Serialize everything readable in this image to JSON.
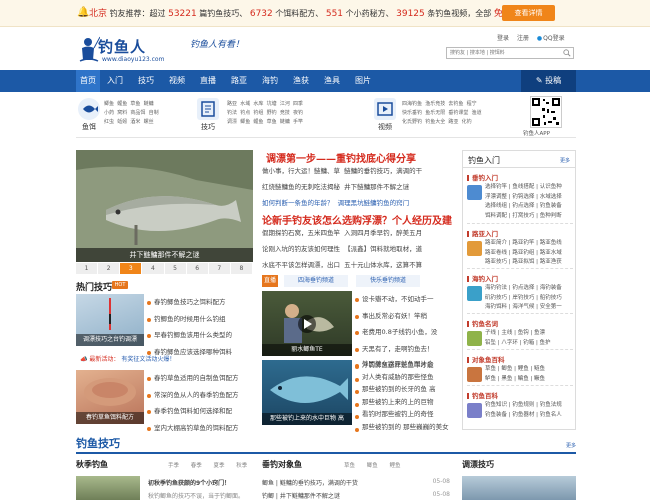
{
  "promo": {
    "location": "北京",
    "prefix": "钓友推荐：超过",
    "n1": "53221",
    "t1": "篇钓鱼技巧、",
    "n2": "6732",
    "t2": "个饵料配方、",
    "n3": "551",
    "t3": "个小药秘方、",
    "n4": "39125",
    "t4": "条钓鱼视频，全部",
    "free": "免费！",
    "button": "查看详情"
  },
  "header": {
    "brand": "钓鱼人",
    "url": "www.diaoyu123.com",
    "slogan": "钓鱼人有看！",
    "login": "登录",
    "register": "注册",
    "qq_login": "QQ登录",
    "search_placeholder": "搜钓友 | 搜本地 | 搜饵料"
  },
  "nav": {
    "items": [
      "首页",
      "入门",
      "技巧",
      "视频",
      "直播",
      "路亚",
      "海钓",
      "渔获",
      "渔具",
      "图片"
    ],
    "post": "投稿"
  },
  "cats": {
    "bait": {
      "name": "鱼饵",
      "links": [
        [
          "鲫鱼",
          "鲤鱼",
          "草鱼",
          "鲢鳙"
        ],
        [
          "小药",
          "窝料",
          "商品饵",
          "自制"
        ],
        [
          "红虫",
          "蚯蚓",
          "酒米",
          "螺丝"
        ]
      ]
    },
    "skill": {
      "name": "技巧",
      "links": [
        [
          "路亚",
          "水域",
          "水库",
          "坑塘",
          "江河",
          "四季"
        ],
        [
          "钓法",
          "钓点",
          "钓组",
          "野钓",
          "竞技",
          "夜钓"
        ],
        [
          "调漂",
          "鲫鱼",
          "鲤鱼",
          "草鱼",
          "鲢鳙",
          "手竿"
        ]
      ]
    },
    "video": {
      "name": "视频",
      "links": [
        [
          "四海钓鱼",
          "渔乐竞技",
          "去钓鱼",
          "程宁"
        ],
        [
          "快乐垂钓",
          "鱼乐无限",
          "垂钓课堂",
          "渔道"
        ],
        [
          "化氏野钓",
          "钓鱼大全",
          "路亚",
          "化钓"
        ]
      ]
    },
    "app": "钓鱼人APP"
  },
  "hero": {
    "caption": "井下鲢鳙那件不解之谜",
    "pages": [
      "1",
      "2",
      "3",
      "4",
      "5",
      "6",
      "7",
      "8"
    ],
    "active_page": "3",
    "headline1": "调漂第一步——重钓找底心得分享",
    "h1_links": [
      [
        "做小事，行大运！鲢鳙、草",
        "鲢鳙的垂钓技巧，满调的干"
      ],
      [
        "红烧鲢鳙鱼的无刺吃法揭秘",
        "井下鲢鳙那件不解之谜"
      ],
      [
        "如何判断一条鱼的年龄？",
        "调理黑坑鲢鳙钓鱼的窍门"
      ]
    ],
    "headline2": "论新手钓友该怎么选购浮漂？个人经历及建",
    "h2_links": [
      [
        "假期探钓石窝，五米四鱼竿",
        "入洞四月季早钓，醉美五月"
      ],
      [
        "论刚入坑的钓友该如何理性",
        "【派鑫】饵料就地取材，道"
      ],
      [
        "水底不平该怎样调漂，出口",
        "五十元山体水库，这算不算"
      ]
    ]
  },
  "hot": {
    "title": "热门技巧",
    "badge": "HOT",
    "thumb1_caption": "调漂技巧之台钓调漂",
    "list1": [
      "春钓鲫鱼技巧之饵料配方",
      "钓鲫鱼的时候用什么钓组",
      "早春钓鲫鱼该用什么类型的",
      "春钓鲫鱼应该选择哪种饵料"
    ],
    "ad": "最新活动：",
    "ad_link": "有奖征文活动火爆！",
    "thumb2_caption": "春钓草鱼饵料配方",
    "list2": [
      "春钓草鱼适用的自制鱼饵配方",
      "常深的鱼从人的春季钓鱼配方",
      "春季钓鱼饵料如何选择和配",
      "室内大棚高钓草鱼的饵料配方"
    ]
  },
  "videos": {
    "tab1": "直播",
    "tab2": "四海垂钓频道",
    "tab3": "快乐垂钓频道",
    "thumb1_caption": "丽水鲫鱼TE",
    "list1": [
      "设卡瓣不动，不如动手一",
      "事出反常必有妖！竿稍",
      "老费用0.8子线钓小鱼，没",
      "天黑有了，走啊钓鱼去！",
      "浮钓鲫鱼这样选鱼平才能"
    ],
    "thumb2_caption": "那些被钓上来的水中巨物 高",
    "list2": [
      "外国美女路亚鲈鱼图片合",
      "对人类有威胁的那些怪鱼",
      "那些被钓到的长牙的鱼 高",
      "那些被钓上来的上的巨物",
      "看钓时那些被钓上的奇怪",
      "那些被钓到的 那些巍巍的美女"
    ]
  },
  "rcol": {
    "title": "钓鱼入门",
    "more": "更多",
    "blocks": [
      {
        "title": "垂钓入门",
        "links": [
          "选择钓竿 | 鱼线搭配 | 认识鱼种",
          "浮漂调整 | 钓钩选择 | 水域选择",
          "选择线组 | 钓点选择 | 钓鱼装备",
          "饵料调配 | 打窝技巧 | 鱼种判断"
        ]
      },
      {
        "title": "路亚入门",
        "links": [
          "路亚简介 | 路亚钓竿 | 路亚鱼线",
          "路亚卷线 | 路亚钓组 | 路亚水域",
          "路亚技巧 | 路亚拟饵 | 路亚渔获"
        ]
      },
      {
        "title": "海钓入门",
        "links": [
          "海钓钓法 | 钓点选择 | 海钓装备",
          "矶钓技巧 | 岸钓技巧 | 船钓技巧",
          "海钓饵料 | 海洋气候 | 安全第一"
        ]
      },
      {
        "title": "钓鱼名词",
        "links": [
          "子线 | 主线 | 鱼钩 | 鱼漂",
          "铅坠 | 八字环 | 钓箱 | 鱼护"
        ]
      },
      {
        "title": "对象鱼百科",
        "links": [
          "草鱼 | 鲫鱼 | 鲤鱼 | 鲢鱼",
          "鲈鱼 | 黑鱼 | 鳊鱼 | 鳜鱼"
        ]
      },
      {
        "title": "钓鱼百科",
        "links": [
          "钓鱼知识 | 钓鱼规则 | 钓鱼法规",
          "钓鱼装备 | 钓鱼器材 | 钓鱼名人"
        ]
      }
    ]
  },
  "bottom": {
    "title": "钓鱼技巧",
    "more": "更多",
    "col1_title": "秋季钓鱼",
    "col1_tabs": [
      "手季",
      "春季",
      "夏季",
      "秋季"
    ],
    "col1_text1": "初秋季钓鱼获颇的9个小窍门！",
    "col1_text2": "秋钓鲫鱼的技巧不误，当于钓鲫面。",
    "col2_title": "垂钓对象鱼",
    "col2_tabs": [
      "草鱼",
      "鲫鱼",
      "鲤鱼"
    ],
    "col2_items": [
      {
        "tag": "鲫鱼",
        "text": "鲢鳙的垂钓技巧，满调的干货",
        "date": "05-08"
      },
      {
        "tag": "钓鲫",
        "text": "井下鲢鳙那件不解之谜",
        "date": "05-08"
      }
    ],
    "col3_title": "调漂技巧"
  }
}
